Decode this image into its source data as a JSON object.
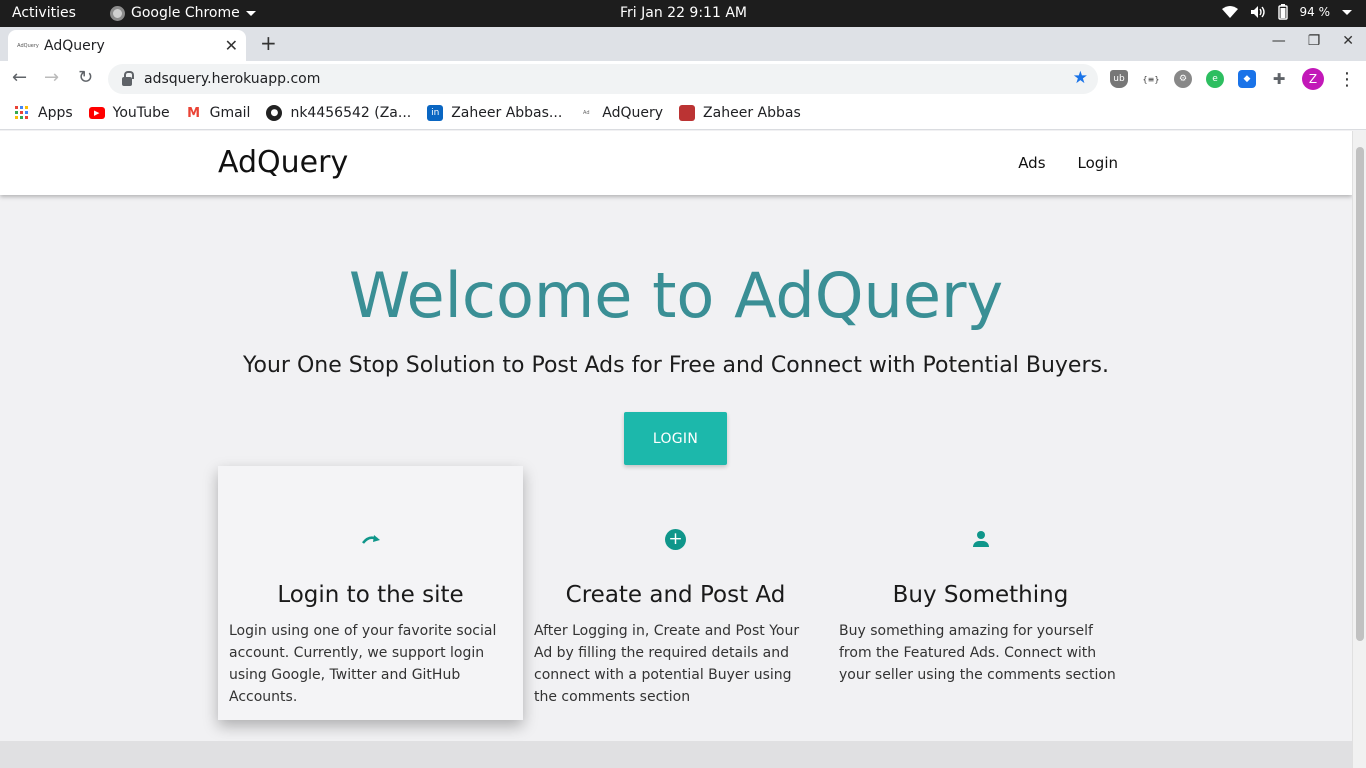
{
  "os_bar": {
    "activities": "Activities",
    "app_name": "Google Chrome",
    "clock": "Fri Jan 22   9:11 AM",
    "battery": "94 %"
  },
  "browser": {
    "tab_title": "AdQuery",
    "tab_favicon_text": "AdQuery",
    "url": "adsquery.herokuapp.com",
    "profile_initial": "Z",
    "extension_json_label": "{≡}",
    "bookmarks": [
      {
        "label": "Apps",
        "icon": "apps-grid-icon"
      },
      {
        "label": "YouTube",
        "icon": "youtube-icon"
      },
      {
        "label": "Gmail",
        "icon": "gmail-icon"
      },
      {
        "label": "nk4456542 (Za...",
        "icon": "github-icon"
      },
      {
        "label": "Zaheer Abbas...",
        "icon": "linkedin-icon"
      },
      {
        "label": "AdQuery",
        "icon": "adquery-favicon"
      },
      {
        "label": "Zaheer Abbas",
        "icon": "profile-photo-icon"
      }
    ]
  },
  "site": {
    "brand": "AdQuery",
    "nav": {
      "ads": "Ads",
      "login": "Login"
    },
    "hero": {
      "title": "Welcome to AdQuery",
      "subtitle": "Your One Stop Solution to Post Ads for Free and Connect with Potential Buyers.",
      "cta": "LOGIN"
    },
    "features": [
      {
        "title": "Login to the site",
        "text": "Login using one of your favorite social account. Currently, we support login using Google, Twitter and GitHub Accounts.",
        "icon": "redo-arrow-icon"
      },
      {
        "title": "Create and Post Ad",
        "text": "After Logging in, Create and Post Your Ad by filling the required details and connect with a potential Buyer using the comments section",
        "icon": "add-circle-icon"
      },
      {
        "title": "Buy Something",
        "text": "Buy something amazing for yourself from the Featured Ads. Connect with your seller using the comments section",
        "icon": "person-icon"
      }
    ],
    "colors": {
      "accent": "#1cb8ab",
      "title": "#3a8f95",
      "icon": "#0f968a"
    }
  }
}
